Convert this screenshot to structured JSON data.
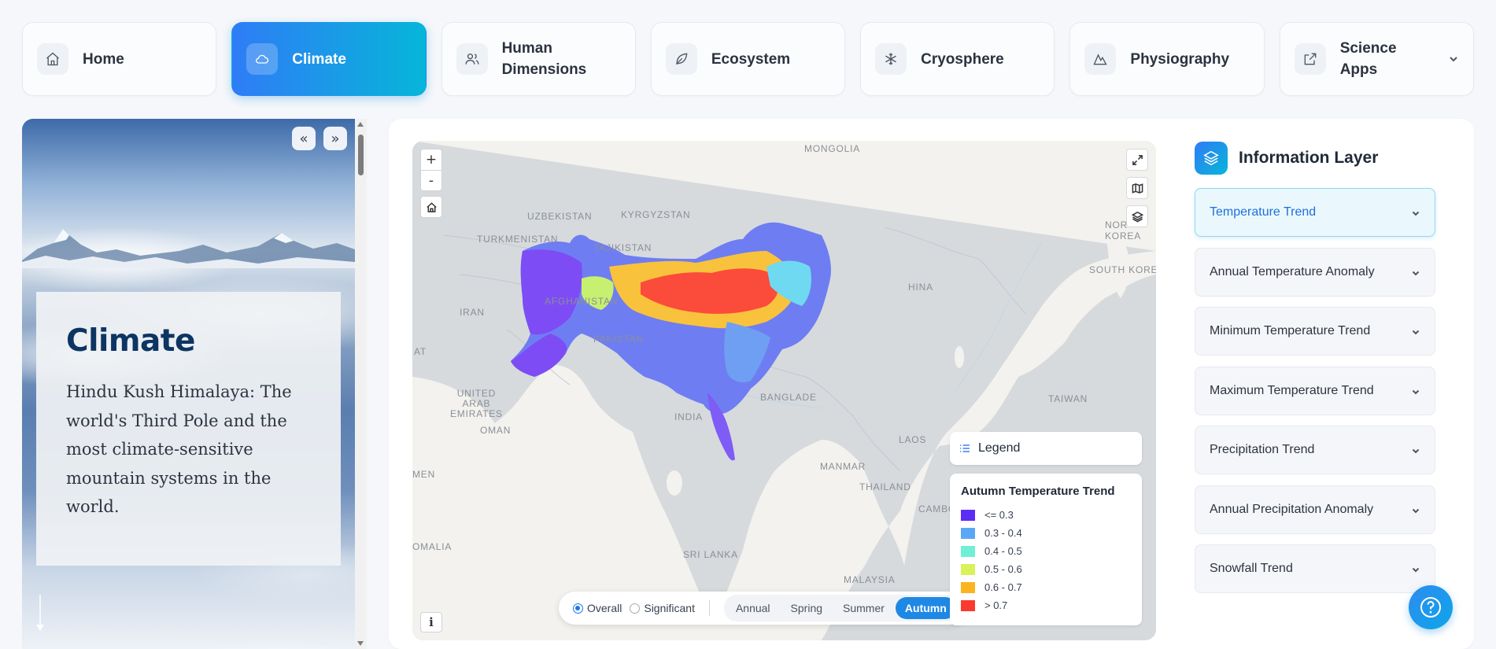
{
  "nav": {
    "items": [
      {
        "label": "Home",
        "icon": "home-icon",
        "active": false
      },
      {
        "label": "Climate",
        "icon": "cloud-icon",
        "active": true
      },
      {
        "label": "Human Dimensions",
        "icon": "users-icon",
        "active": false
      },
      {
        "label": "Ecosystem",
        "icon": "leaf-icon",
        "active": false
      },
      {
        "label": "Cryosphere",
        "icon": "snowflake-icon",
        "active": false
      },
      {
        "label": "Physiography",
        "icon": "mountain-icon",
        "active": false
      },
      {
        "label": "Science Apps",
        "icon": "external-link-icon",
        "active": false,
        "has_dropdown": true
      }
    ]
  },
  "story": {
    "prev_glyph": "«",
    "next_glyph": "»",
    "title": "Climate",
    "body": "Hindu Kush Himalaya: The world's Third Pole and the most climate-sensitive mountain systems in the world."
  },
  "map": {
    "zoom_in": "+",
    "zoom_out": "-",
    "info_glyph": "i",
    "country_labels": [
      "MONGOLIA",
      "UZBEKISTAN",
      "KYRGYZSTAN",
      "TURKMENISTAN",
      "TAJIKISTAN",
      "NORTH KOREA",
      "SOUTH KOREA",
      "AFGHANISTAN",
      "IRAN",
      "CHINA",
      "PAKISTAN",
      "QATAR",
      "UNITED ARAB EMIRATES",
      "BANGLADESH",
      "TAIWAN",
      "INDIA",
      "OMAN",
      "LAOS",
      "YEMEN",
      "MYANMAR",
      "THAILAND",
      "CAMBODIA",
      "SOMALIA",
      "SRI LANKA",
      "MALAYSIA"
    ],
    "visible_label_text": [
      "MONGOLIA",
      "UZBEKISTAN",
      "KYRGYZSTAN",
      "TURKMENISTAN",
      "TAJIKISTAN",
      "NOR KOREA",
      "SOUTH KORE",
      "AFGHANISTAN",
      "IRAN",
      "HINA",
      "PAKISTAN",
      "AT",
      "UNITED ARAB EMIRATES",
      "BANGLADE",
      "TAIWAN",
      "INDIA",
      "OMAN",
      "LAOS",
      "MEN",
      "MANMAR",
      "THAILAND",
      "CAMBODIA",
      "OMALIA",
      "SRI LANKA",
      "MALAYSIA"
    ],
    "mode_options": [
      {
        "label": "Overall",
        "selected": true
      },
      {
        "label": "Significant",
        "selected": false
      }
    ],
    "seasons": [
      {
        "label": "Annual",
        "selected": false
      },
      {
        "label": "Spring",
        "selected": false
      },
      {
        "label": "Summer",
        "selected": false
      },
      {
        "label": "Autumn",
        "selected": true
      }
    ],
    "legend": {
      "button_label": "Legend",
      "title": "Autumn Temperature Trend",
      "classes": [
        {
          "label": "<= 0.3",
          "color": "#5b2cf5"
        },
        {
          "label": "0.3 - 0.4",
          "color": "#5aa8f5"
        },
        {
          "label": "0.4 - 0.5",
          "color": "#6ff0d5"
        },
        {
          "label": "0.5 - 0.6",
          "color": "#d9f25a"
        },
        {
          "label": "0.6 - 0.7",
          "color": "#fbb41f"
        },
        {
          "label": "> 0.7",
          "color": "#fb3a2f"
        }
      ]
    }
  },
  "info_layer": {
    "title": "Information Layer",
    "items": [
      {
        "label": "Temperature Trend",
        "active": true
      },
      {
        "label": "Annual Temperature Anomaly",
        "active": false
      },
      {
        "label": "Minimum Temperature Trend",
        "active": false
      },
      {
        "label": "Maximum Temperature Trend",
        "active": false
      },
      {
        "label": "Precipitation Trend",
        "active": false
      },
      {
        "label": "Annual Precipitation Anomaly",
        "active": false
      },
      {
        "label": "Snowfall Trend",
        "active": false
      }
    ]
  },
  "colors": {
    "accent_start": "#2f7cf6",
    "accent_end": "#06b6d9",
    "active_season": "#1e88e5",
    "active_accordion_text": "#1e6fd9"
  }
}
